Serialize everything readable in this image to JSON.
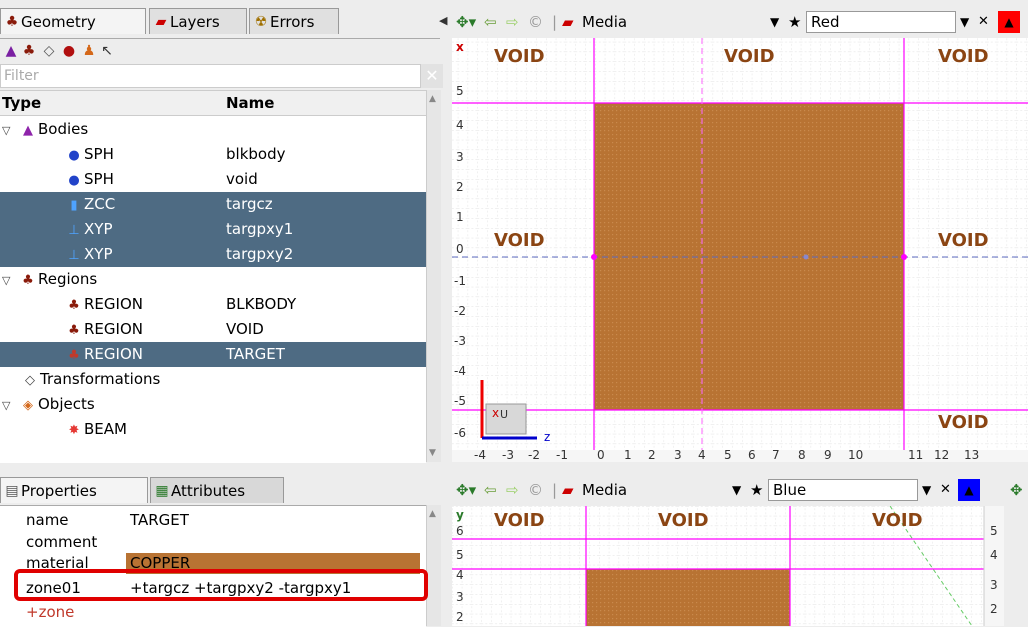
{
  "tabs": {
    "geometry": "Geometry",
    "layers": "Layers",
    "errors": "Errors"
  },
  "filter": {
    "placeholder": "Filter"
  },
  "tree": {
    "headers": {
      "type": "Type",
      "name": "Name"
    },
    "rows": [
      {
        "type": "Bodies",
        "name": "",
        "selected": false
      },
      {
        "type": "SPH",
        "name": "blkbody",
        "selected": false
      },
      {
        "type": "SPH",
        "name": "void",
        "selected": false
      },
      {
        "type": "ZCC",
        "name": "targcz",
        "selected": true
      },
      {
        "type": "XYP",
        "name": "targpxy1",
        "selected": true
      },
      {
        "type": "XYP",
        "name": "targpxy2",
        "selected": true
      },
      {
        "type": "Regions",
        "name": "",
        "selected": false
      },
      {
        "type": "REGION",
        "name": "BLKBODY",
        "selected": false
      },
      {
        "type": "REGION",
        "name": "VOID",
        "selected": false
      },
      {
        "type": "REGION",
        "name": "TARGET",
        "selected": true
      },
      {
        "type": "Transformations",
        "name": "",
        "selected": false
      },
      {
        "type": "Objects",
        "name": "",
        "selected": false
      },
      {
        "type": "BEAM",
        "name": "",
        "selected": false
      }
    ]
  },
  "prop_tabs": {
    "properties": "Properties",
    "attributes": "Attributes"
  },
  "properties": [
    {
      "key": "name",
      "value": "TARGET"
    },
    {
      "key": "comment",
      "value": ""
    },
    {
      "key": "material",
      "value": "COPPER"
    },
    {
      "key": "zone01",
      "value": "+targcz +targpxy2 -targpxy1"
    },
    {
      "key": "+zone",
      "value": ""
    }
  ],
  "viewport_top": {
    "layer": "Media",
    "color": "Red",
    "axis_v": "x",
    "axis_h": "z",
    "y_ticks": [
      "5",
      "4",
      "3",
      "2",
      "1",
      "0",
      "-1",
      "-2",
      "-3",
      "-4",
      "-5",
      "-6"
    ],
    "x_ticks": [
      "-4",
      "-3",
      "-2",
      "-1",
      "0",
      "1",
      "2",
      "3",
      "4",
      "5",
      "6",
      "7",
      "8",
      "9",
      "10",
      "11",
      "12",
      "13"
    ],
    "labels": [
      "VOID",
      "VOID",
      "VOID",
      "VOID",
      "VOID",
      "VOID"
    ],
    "gizmo": "U"
  },
  "viewport_bottom": {
    "layer": "Media",
    "color": "Blue",
    "axis_v": "y",
    "y_ticks": [
      "6",
      "5",
      "4",
      "3",
      "2"
    ],
    "right_ticks": [
      "5",
      "4",
      "3",
      "2"
    ],
    "labels": [
      "VOID",
      "VOID",
      "VOID"
    ]
  },
  "colors": {
    "selection": "#4e6b83",
    "copper": "#b87333",
    "grid": "#cccccc",
    "boundary": "#ff00ff",
    "highlight": "#e00000",
    "accent_red": "#ff0000",
    "accent_blue": "#0000ff"
  }
}
